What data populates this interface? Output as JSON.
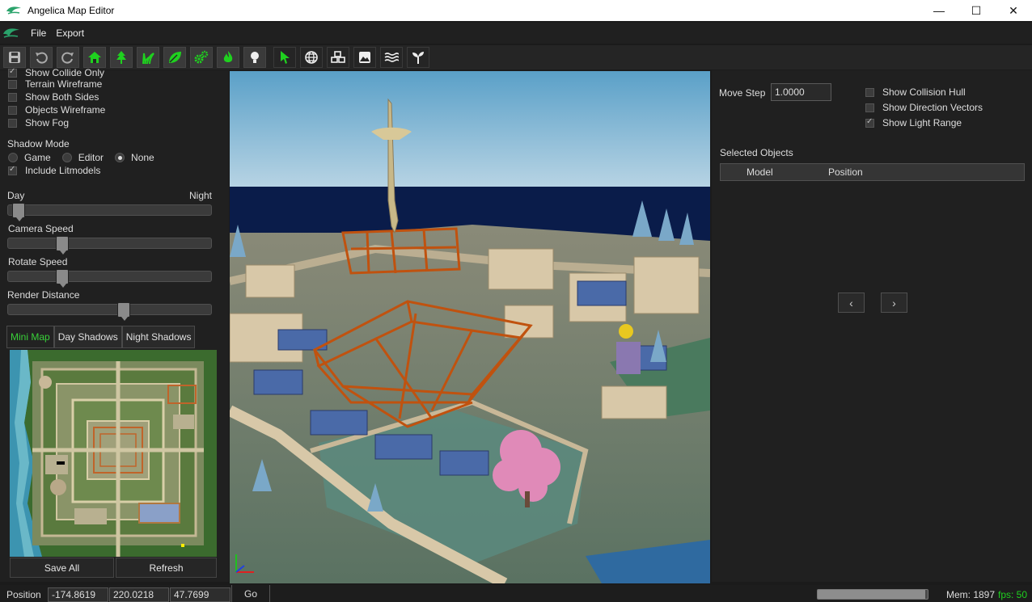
{
  "window": {
    "title": "Angelica Map Editor",
    "minimize": "—",
    "maximize": "☐",
    "close": "✕"
  },
  "menu": {
    "items": [
      "File",
      "Export"
    ]
  },
  "toolbar": {
    "buttons": [
      "save-icon",
      "undo-icon",
      "redo-icon",
      "house-icon",
      "tree-icon",
      "grass-icon",
      "leaf-icon",
      "gears-icon",
      "fire-icon",
      "lightbulb-icon",
      "cursor-icon",
      "globe-icon",
      "objects-icon",
      "landscape-icon",
      "water-icon",
      "sprout-icon"
    ],
    "accent": "#1fd11f"
  },
  "left": {
    "checkboxes": [
      {
        "label": "Show Collide Only",
        "checked": true
      },
      {
        "label": "Terrain Wireframe",
        "checked": false
      },
      {
        "label": "Show Both Sides",
        "checked": false
      },
      {
        "label": "Objects Wireframe",
        "checked": false
      },
      {
        "label": "Show Fog",
        "checked": false
      }
    ],
    "shadow_mode_label": "Shadow Mode",
    "shadow_modes": [
      {
        "label": "Game",
        "selected": false
      },
      {
        "label": "Editor",
        "selected": false
      },
      {
        "label": "None",
        "selected": true
      }
    ],
    "include_litmodels": {
      "label": "Include Litmodels",
      "checked": true
    },
    "day_label": "Day",
    "night_label": "Night",
    "day_night_value": 0.02,
    "camera_speed_label": "Camera Speed",
    "camera_speed_value": 0.25,
    "rotate_speed_label": "Rotate Speed",
    "rotate_speed_value": 0.25,
    "render_distance_label": "Render Distance",
    "render_distance_value": 0.57,
    "tabs": [
      {
        "label": "Mini Map",
        "active": true
      },
      {
        "label": "Day Shadows",
        "active": false
      },
      {
        "label": "Night Shadows",
        "active": false
      }
    ],
    "save_all": "Save All",
    "refresh": "Refresh"
  },
  "right": {
    "move_step_label": "Move Step",
    "move_step_value": "1.0000",
    "options": [
      {
        "label": "Show Collision Hull",
        "checked": false
      },
      {
        "label": "Show Direction Vectors",
        "checked": false
      },
      {
        "label": "Show Light Range",
        "checked": true
      }
    ],
    "selected_objects_label": "Selected Objects",
    "columns": [
      "Model",
      "Position"
    ],
    "prev": "‹",
    "next": "›"
  },
  "status": {
    "position_label": "Position",
    "x": "-174.8619",
    "y": "220.0218",
    "z": "47.7699",
    "go": "Go",
    "progress": 0.98,
    "mem": "Mem: 1897",
    "fps": "fps: 50",
    "fps_color": "#1fd11f"
  }
}
